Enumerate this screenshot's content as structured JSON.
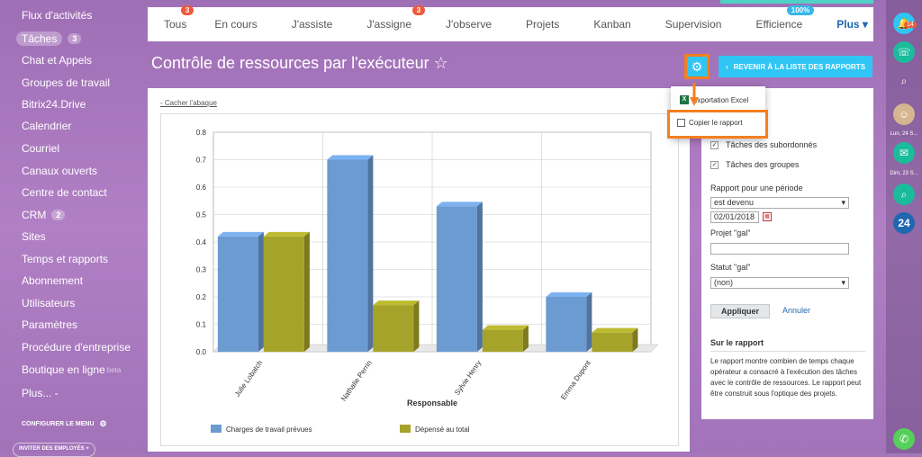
{
  "sidebar": {
    "items": [
      {
        "label": "Flux d'activités"
      },
      {
        "label": "Tâches",
        "count": "3"
      },
      {
        "label": "Chat et Appels"
      },
      {
        "label": "Groupes de travail"
      },
      {
        "label": "Bitrix24.Drive"
      },
      {
        "label": "Calendrier"
      },
      {
        "label": "Courriel"
      },
      {
        "label": "Canaux ouverts"
      },
      {
        "label": "Centre de contact"
      },
      {
        "label": "CRM",
        "count": "2"
      },
      {
        "label": "Sites"
      },
      {
        "label": "Temps et rapports"
      },
      {
        "label": "Abonnement"
      },
      {
        "label": "Utilisateurs"
      },
      {
        "label": "Paramètres"
      },
      {
        "label": "Procédure d'entreprise"
      },
      {
        "label": "Boutique en ligne",
        "beta": "beta"
      },
      {
        "label": "Plus... -"
      }
    ],
    "config_menu": "CONFIGURER LE MENU",
    "invite": "INVITER DES EMPLOYÉS +"
  },
  "tabs": [
    {
      "label": "Tous",
      "badge": "3"
    },
    {
      "label": "En cours"
    },
    {
      "label": "J'assiste"
    },
    {
      "label": "J'assigne",
      "badge": "3"
    },
    {
      "label": "J'observe"
    },
    {
      "label": "Projets"
    },
    {
      "label": "Kanban"
    },
    {
      "label": "Supervision"
    },
    {
      "label": "Efficience",
      "badge": "100%"
    },
    {
      "label": "Plus ▾"
    }
  ],
  "page_title": "Contrôle de ressources par l'exécuteur ☆",
  "back_button": "REVENIR À LA LISTE DES RAPPORTS",
  "hide_link": "- Cacher l'abaque",
  "popup": {
    "export": "Exportation Excel",
    "copy": "Copier le rapport"
  },
  "right_panel": {
    "check_sub": "Tâches des subordonnés",
    "check_groups": "Tâches des groupes",
    "period_label": "Rapport pour une période",
    "period_value": "est devenu",
    "date_value": "02/01/2018",
    "project_label": "Projet \"gal\"",
    "status_label": "Statut \"gal\"",
    "status_value": "(non)",
    "apply": "Appliquer",
    "cancel": "Annuler",
    "about_title": "Sur le rapport",
    "about_text": "Le rapport montre combien de temps chaque opérateur a consacré à l'exécution des tâches avec le contrôle de ressources. Le rapport peut être construit sous l'optique des projets."
  },
  "rail": {
    "notif_count": "14",
    "date1": "Lun, 24 S...",
    "date2": "Dim, 23 S...",
    "b24": "24"
  },
  "colors": {
    "accent": "#2fc6f6",
    "highlight": "#f47f20",
    "series1": "#6c9bd2",
    "series2": "#a6a32a"
  },
  "chart_data": {
    "type": "bar",
    "categories": [
      "Julie Lobatch",
      "Nathalie Perrin",
      "Sylvie Henry",
      "Emma Dupont"
    ],
    "series": [
      {
        "name": "Charges de travail prévues",
        "values": [
          0.42,
          0.7,
          0.53,
          0.2
        ]
      },
      {
        "name": "Dépensé au total",
        "values": [
          0.42,
          0.17,
          0.08,
          0.07
        ]
      }
    ],
    "xlabel": "Responsable",
    "ylabel": "",
    "ylim": [
      0,
      0.8
    ],
    "yticks": [
      "0.0",
      "0.1",
      "0.2",
      "0.3",
      "0.4",
      "0.5",
      "0.6",
      "0.7",
      "0.8"
    ],
    "grid": true,
    "legend": "bottom"
  }
}
